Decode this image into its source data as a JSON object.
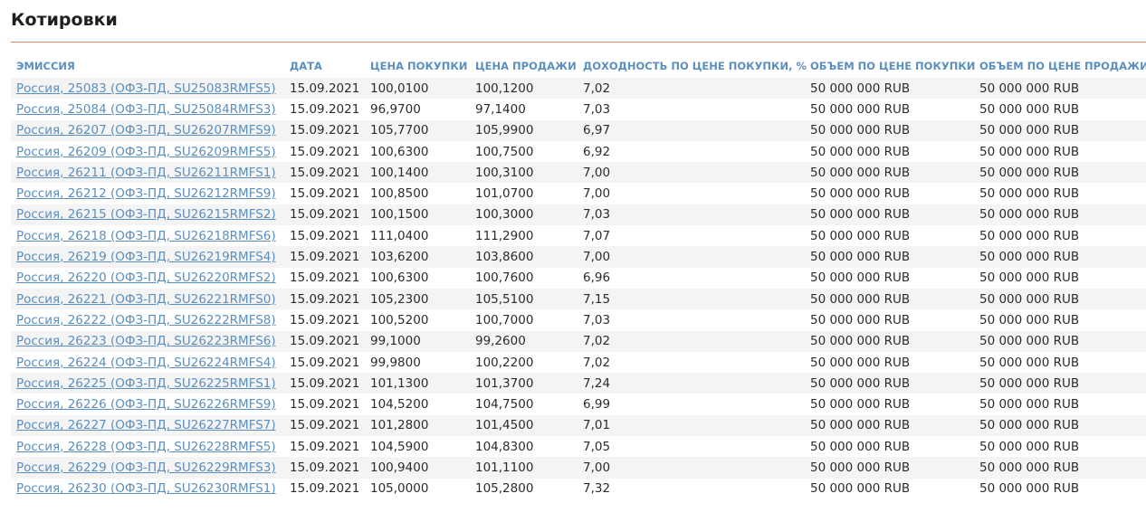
{
  "page_title": "Котировки",
  "colors": {
    "accent_rule": "#d9895f",
    "header_text": "#5b8fbf",
    "link": "#5b8fbf",
    "stripe": "#f4f4f4"
  },
  "columns": [
    "ЭМИССИЯ",
    "ДАТА",
    "ЦЕНА ПОКУПКИ",
    "ЦЕНА ПРОДАЖИ",
    "ДОХОДНОСТЬ ПО ЦЕНЕ ПОКУПКИ, %",
    "ОБЪЕМ ПО ЦЕНЕ ПОКУПКИ",
    "ОБЪЕМ ПО ЦЕНЕ ПРОДАЖИ"
  ],
  "rows": [
    {
      "emission": "Россия, 25083 (ОФЗ-ПД, SU25083RMFS5)",
      "date": "15.09.2021",
      "bid": "100,0100",
      "ask": "100,1200",
      "yield": "7,02",
      "bid_volume": "50 000 000 RUB",
      "ask_volume": "50 000 000 RUB"
    },
    {
      "emission": "Россия, 25084 (ОФЗ-ПД, SU25084RMFS3)",
      "date": "15.09.2021",
      "bid": "96,9700",
      "ask": "97,1400",
      "yield": "7,03",
      "bid_volume": "50 000 000 RUB",
      "ask_volume": "50 000 000 RUB"
    },
    {
      "emission": "Россия, 26207 (ОФЗ-ПД, SU26207RMFS9)",
      "date": "15.09.2021",
      "bid": "105,7700",
      "ask": "105,9900",
      "yield": "6,97",
      "bid_volume": "50 000 000 RUB",
      "ask_volume": "50 000 000 RUB"
    },
    {
      "emission": "Россия, 26209 (ОФЗ-ПД, SU26209RMFS5)",
      "date": "15.09.2021",
      "bid": "100,6300",
      "ask": "100,7500",
      "yield": "6,92",
      "bid_volume": "50 000 000 RUB",
      "ask_volume": "50 000 000 RUB"
    },
    {
      "emission": "Россия, 26211 (ОФЗ-ПД, SU26211RMFS1)",
      "date": "15.09.2021",
      "bid": "100,1400",
      "ask": "100,3100",
      "yield": "7,00",
      "bid_volume": "50 000 000 RUB",
      "ask_volume": "50 000 000 RUB"
    },
    {
      "emission": "Россия, 26212 (ОФЗ-ПД, SU26212RMFS9)",
      "date": "15.09.2021",
      "bid": "100,8500",
      "ask": "101,0700",
      "yield": "7,00",
      "bid_volume": "50 000 000 RUB",
      "ask_volume": "50 000 000 RUB"
    },
    {
      "emission": "Россия, 26215 (ОФЗ-ПД, SU26215RMFS2)",
      "date": "15.09.2021",
      "bid": "100,1500",
      "ask": "100,3000",
      "yield": "7,03",
      "bid_volume": "50 000 000 RUB",
      "ask_volume": "50 000 000 RUB"
    },
    {
      "emission": "Россия, 26218 (ОФЗ-ПД, SU26218RMFS6)",
      "date": "15.09.2021",
      "bid": "111,0400",
      "ask": "111,2900",
      "yield": "7,07",
      "bid_volume": "50 000 000 RUB",
      "ask_volume": "50 000 000 RUB"
    },
    {
      "emission": "Россия, 26219 (ОФЗ-ПД, SU26219RMFS4)",
      "date": "15.09.2021",
      "bid": "103,6200",
      "ask": "103,8600",
      "yield": "7,00",
      "bid_volume": "50 000 000 RUB",
      "ask_volume": "50 000 000 RUB"
    },
    {
      "emission": "Россия, 26220 (ОФЗ-ПД, SU26220RMFS2)",
      "date": "15.09.2021",
      "bid": "100,6300",
      "ask": "100,7600",
      "yield": "6,96",
      "bid_volume": "50 000 000 RUB",
      "ask_volume": "50 000 000 RUB"
    },
    {
      "emission": "Россия, 26221 (ОФЗ-ПД, SU26221RMFS0)",
      "date": "15.09.2021",
      "bid": "105,2300",
      "ask": "105,5100",
      "yield": "7,15",
      "bid_volume": "50 000 000 RUB",
      "ask_volume": "50 000 000 RUB"
    },
    {
      "emission": "Россия, 26222 (ОФЗ-ПД, SU26222RMFS8)",
      "date": "15.09.2021",
      "bid": "100,5200",
      "ask": "100,7000",
      "yield": "7,03",
      "bid_volume": "50 000 000 RUB",
      "ask_volume": "50 000 000 RUB"
    },
    {
      "emission": "Россия, 26223 (ОФЗ-ПД, SU26223RMFS6)",
      "date": "15.09.2021",
      "bid": "99,1000",
      "ask": "99,2600",
      "yield": "7,02",
      "bid_volume": "50 000 000 RUB",
      "ask_volume": "50 000 000 RUB"
    },
    {
      "emission": "Россия, 26224 (ОФЗ-ПД, SU26224RMFS4)",
      "date": "15.09.2021",
      "bid": "99,9800",
      "ask": "100,2200",
      "yield": "7,02",
      "bid_volume": "50 000 000 RUB",
      "ask_volume": "50 000 000 RUB"
    },
    {
      "emission": "Россия, 26225 (ОФЗ-ПД, SU26225RMFS1)",
      "date": "15.09.2021",
      "bid": "101,1300",
      "ask": "101,3700",
      "yield": "7,24",
      "bid_volume": "50 000 000 RUB",
      "ask_volume": "50 000 000 RUB"
    },
    {
      "emission": "Россия, 26226 (ОФЗ-ПД, SU26226RMFS9)",
      "date": "15.09.2021",
      "bid": "104,5200",
      "ask": "104,7500",
      "yield": "6,99",
      "bid_volume": "50 000 000 RUB",
      "ask_volume": "50 000 000 RUB"
    },
    {
      "emission": "Россия, 26227 (ОФЗ-ПД, SU26227RMFS7)",
      "date": "15.09.2021",
      "bid": "101,2800",
      "ask": "101,4500",
      "yield": "7,01",
      "bid_volume": "50 000 000 RUB",
      "ask_volume": "50 000 000 RUB"
    },
    {
      "emission": "Россия, 26228 (ОФЗ-ПД, SU26228RMFS5)",
      "date": "15.09.2021",
      "bid": "104,5900",
      "ask": "104,8300",
      "yield": "7,05",
      "bid_volume": "50 000 000 RUB",
      "ask_volume": "50 000 000 RUB"
    },
    {
      "emission": "Россия, 26229 (ОФЗ-ПД, SU26229RMFS3)",
      "date": "15.09.2021",
      "bid": "100,9400",
      "ask": "101,1100",
      "yield": "7,00",
      "bid_volume": "50 000 000 RUB",
      "ask_volume": "50 000 000 RUB"
    },
    {
      "emission": "Россия, 26230 (ОФЗ-ПД, SU26230RMFS1)",
      "date": "15.09.2021",
      "bid": "105,0000",
      "ask": "105,2800",
      "yield": "7,32",
      "bid_volume": "50 000 000 RUB",
      "ask_volume": "50 000 000 RUB"
    }
  ]
}
